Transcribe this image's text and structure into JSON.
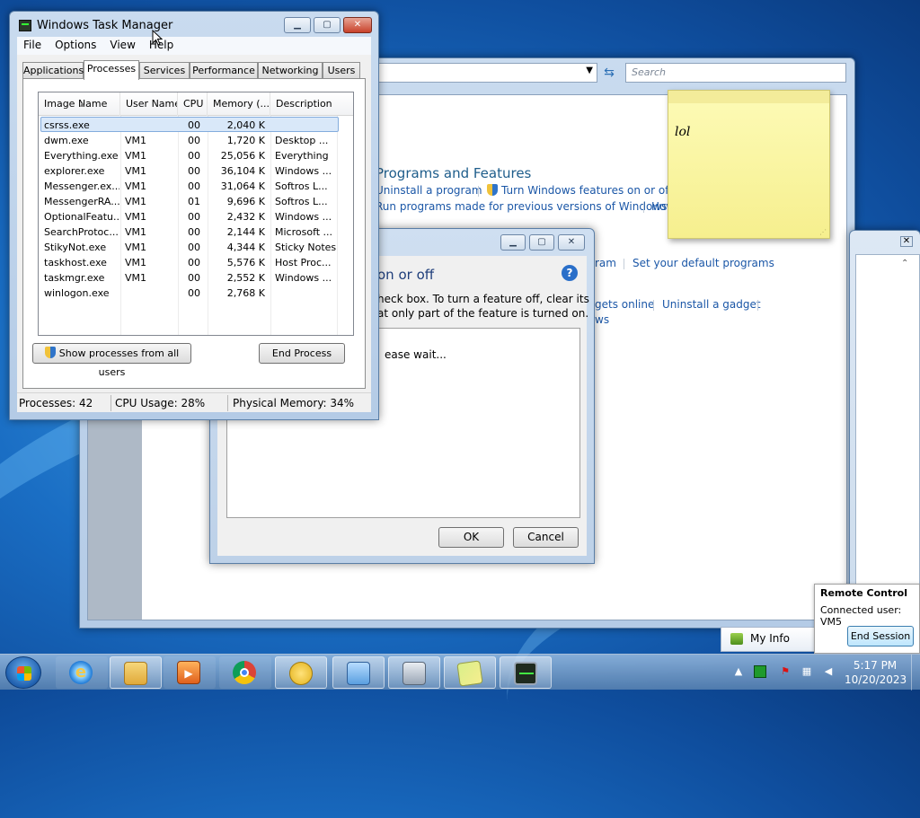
{
  "control_panel": {
    "search_placeholder": "Search",
    "title": "Programs and Features",
    "links": {
      "uninstall_program": "Uninstall a program",
      "turn_features": "Turn Windows features on or off",
      "run_programs": "Run programs made for previous versions of Windows",
      "how_partial": "How",
      "program_partial": "ram",
      "set_default": "Set your default programs",
      "gadgets_online": "gets online",
      "uninstall_gadget": "Uninstall a gadget",
      "ws_partial": "ws"
    }
  },
  "features_dialog": {
    "heading": "on or off",
    "desc_line1": "heck box. To turn a feature off, clear its",
    "desc_line2": "at only part of the feature is turned on.",
    "wait_text": "ease wait...",
    "ok_label": "OK",
    "cancel_label": "Cancel",
    "help_glyph": "?"
  },
  "sticky_note": {
    "text": "lol"
  },
  "task_manager": {
    "title": "Windows Task Manager",
    "menu": [
      "File",
      "Options",
      "View",
      "Help"
    ],
    "tabs": [
      "Applications",
      "Processes",
      "Services",
      "Performance",
      "Networking",
      "Users"
    ],
    "selected_tab": "Processes",
    "columns": [
      "Image Name",
      "User Name",
      "CPU",
      "Memory (...",
      "Description"
    ],
    "rows": [
      [
        "csrss.exe",
        "",
        "00",
        "2,040 K",
        ""
      ],
      [
        "dwm.exe",
        "VM1",
        "00",
        "1,720 K",
        "Desktop ..."
      ],
      [
        "Everything.exe",
        "VM1",
        "00",
        "25,056 K",
        "Everything"
      ],
      [
        "explorer.exe",
        "VM1",
        "00",
        "36,104 K",
        "Windows ..."
      ],
      [
        "Messenger.ex...",
        "VM1",
        "00",
        "31,064 K",
        "Softros L..."
      ],
      [
        "MessengerRA...",
        "VM1",
        "01",
        "9,696 K",
        "Softros L..."
      ],
      [
        "OptionalFeatu...",
        "VM1",
        "00",
        "2,432 K",
        "Windows ..."
      ],
      [
        "SearchProtoc...",
        "VM1",
        "00",
        "2,144 K",
        "Microsoft ..."
      ],
      [
        "StikyNot.exe",
        "VM1",
        "00",
        "4,344 K",
        "Sticky Notes"
      ],
      [
        "taskhost.exe",
        "VM1",
        "00",
        "5,576 K",
        "Host Proc..."
      ],
      [
        "taskmgr.exe",
        "VM1",
        "00",
        "2,552 K",
        "Windows ..."
      ],
      [
        "winlogon.exe",
        "",
        "00",
        "2,768 K",
        ""
      ]
    ],
    "show_all_label": "Show processes from all users",
    "end_process_label": "End Process",
    "status": {
      "processes": "Processes: 42",
      "cpu": "CPU Usage: 28%",
      "memory": "Physical Memory: 34%"
    }
  },
  "remote_control": {
    "title": "Remote Control",
    "connected": "Connected user:  VM5",
    "end_session": "End Session",
    "my_info": "My Info"
  },
  "taskbar": {
    "time": "5:17 PM",
    "date": "10/20/2023",
    "icons": [
      "file-explorer-icon",
      "internet-explorer-icon",
      "media-player-icon",
      "chrome-icon",
      "messenger-icon",
      "control-panel-icon",
      "features-icon",
      "sticky-notes-icon",
      "task-manager-icon"
    ]
  },
  "colors": {
    "link": "#1b57a7",
    "cp_title": "#1e5d8b",
    "sticky": "#fdfbb7"
  }
}
